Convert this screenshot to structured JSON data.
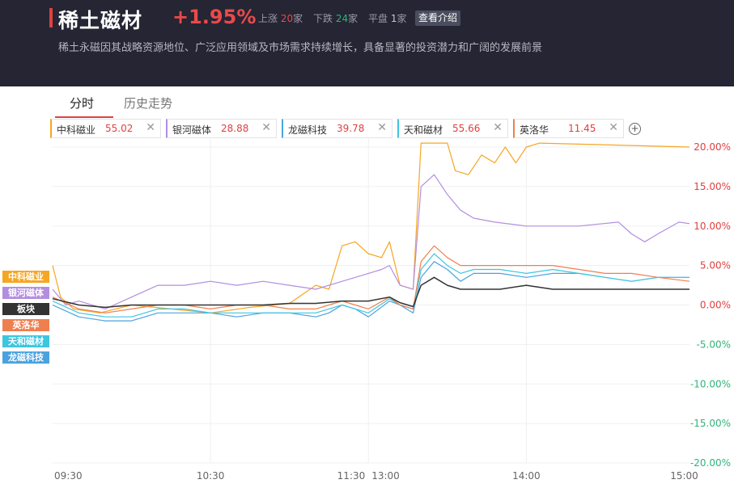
{
  "header": {
    "title": "稀土磁材",
    "change": "+1.95%",
    "up_label": "上涨",
    "up_count": "20",
    "down_label": "下跌",
    "down_count": "24",
    "flat_label": "平盘",
    "flat_count": "1",
    "unit": "家",
    "intro_button": "查看介绍",
    "description": "稀土永磁因其战略资源地位、广泛应用领域及市场需求持续增长，具备显著的投资潜力和广阔的发展前景"
  },
  "tabs": [
    {
      "label": "分时",
      "active": true
    },
    {
      "label": "历史走势",
      "active": false
    }
  ],
  "legend": [
    {
      "name": "中科磁业",
      "value": "55.02",
      "color": "#f5a623"
    },
    {
      "name": "银河磁体",
      "value": "28.88",
      "color": "#b38ee0"
    },
    {
      "name": "龙磁科技",
      "value": "39.78",
      "color": "#4aa3df"
    },
    {
      "name": "天和磁材",
      "value": "55.66",
      "color": "#3ec6e0"
    },
    {
      "name": "英洛华",
      "value": "11.45",
      "color": "#f07f4f"
    }
  ],
  "icons": {
    "close": "close-icon",
    "add": "add-circle-icon"
  },
  "side_tags": [
    {
      "label": "中科磁业",
      "color": "#f5a623"
    },
    {
      "label": "银河磁体",
      "color": "#b38ee0"
    },
    {
      "label": "板块",
      "color": "#333333"
    },
    {
      "label": "英洛华",
      "color": "#f07f4f"
    },
    {
      "label": "天和磁材",
      "color": "#3ec6e0"
    },
    {
      "label": "龙磁科技",
      "color": "#4aa3df"
    }
  ],
  "chart_data": {
    "type": "line",
    "x_ticks": [
      "09:30",
      "10:30",
      "11:30",
      "13:00",
      "14:00",
      "15:00"
    ],
    "y_ticks": [
      "20.00%",
      "15.00%",
      "10.00%",
      "5.00%",
      "0.00%",
      "-5.00%",
      "-10.00%",
      "-15.00%",
      "-20.00%"
    ],
    "ylim": [
      -20,
      20
    ],
    "x_points": 242,
    "positive_color": "#e0403f",
    "negative_color": "#2fb37a",
    "series": [
      {
        "name": "中科磁业",
        "color": "#f5a623",
        "values": [
          [
            0,
            5
          ],
          [
            3,
            1
          ],
          [
            8,
            -0.5
          ],
          [
            18,
            -1
          ],
          [
            30,
            0
          ],
          [
            45,
            -0.5
          ],
          [
            60,
            -1
          ],
          [
            75,
            -0.3
          ],
          [
            90,
            0.2
          ],
          [
            100,
            2.5
          ],
          [
            105,
            2
          ],
          [
            110,
            7.5
          ],
          [
            115,
            8
          ],
          [
            120,
            6.5
          ],
          [
            125,
            6
          ],
          [
            128,
            8
          ],
          [
            132,
            2.5
          ],
          [
            137,
            2
          ],
          [
            140,
            20.5
          ],
          [
            150,
            20.5
          ],
          [
            153,
            17
          ],
          [
            158,
            16.5
          ],
          [
            163,
            19
          ],
          [
            168,
            18
          ],
          [
            172,
            20
          ],
          [
            176,
            18
          ],
          [
            180,
            20
          ],
          [
            185,
            20.5
          ],
          [
            242,
            20
          ]
        ]
      },
      {
        "name": "银河磁体",
        "color": "#b38ee0",
        "values": [
          [
            0,
            2
          ],
          [
            5,
            0
          ],
          [
            10,
            0.5
          ],
          [
            20,
            -0.5
          ],
          [
            30,
            1
          ],
          [
            40,
            2.5
          ],
          [
            50,
            2.5
          ],
          [
            60,
            3
          ],
          [
            70,
            2.5
          ],
          [
            80,
            3
          ],
          [
            90,
            2.5
          ],
          [
            100,
            2
          ],
          [
            110,
            3
          ],
          [
            120,
            4
          ],
          [
            125,
            4.5
          ],
          [
            128,
            5
          ],
          [
            132,
            2.5
          ],
          [
            137,
            2
          ],
          [
            140,
            15
          ],
          [
            145,
            16.5
          ],
          [
            150,
            14
          ],
          [
            155,
            12
          ],
          [
            160,
            11
          ],
          [
            168,
            10.5
          ],
          [
            180,
            10
          ],
          [
            200,
            10
          ],
          [
            215,
            10.5
          ],
          [
            220,
            9
          ],
          [
            225,
            8
          ],
          [
            230,
            9
          ],
          [
            238,
            10.5
          ],
          [
            242,
            10.3
          ]
        ]
      },
      {
        "name": "龙磁科技",
        "color": "#4aa3df",
        "values": [
          [
            0,
            0
          ],
          [
            10,
            -1.5
          ],
          [
            20,
            -2
          ],
          [
            30,
            -2
          ],
          [
            40,
            -1
          ],
          [
            50,
            -1
          ],
          [
            60,
            -1
          ],
          [
            70,
            -1.5
          ],
          [
            80,
            -1
          ],
          [
            90,
            -1
          ],
          [
            100,
            -1.5
          ],
          [
            105,
            -1
          ],
          [
            110,
            0
          ],
          [
            115,
            -0.5
          ],
          [
            120,
            -1.5
          ],
          [
            128,
            0.5
          ],
          [
            132,
            0
          ],
          [
            137,
            -1
          ],
          [
            140,
            3.5
          ],
          [
            145,
            5.5
          ],
          [
            150,
            4.5
          ],
          [
            155,
            3
          ],
          [
            160,
            4
          ],
          [
            170,
            4
          ],
          [
            180,
            3.5
          ],
          [
            190,
            4
          ],
          [
            200,
            4
          ],
          [
            210,
            3.5
          ],
          [
            220,
            3
          ],
          [
            230,
            3.5
          ],
          [
            242,
            3.5
          ]
        ]
      },
      {
        "name": "天和磁材",
        "color": "#3ec6e0",
        "values": [
          [
            0,
            0.5
          ],
          [
            10,
            -1
          ],
          [
            20,
            -1.5
          ],
          [
            30,
            -1.5
          ],
          [
            40,
            -0.5
          ],
          [
            50,
            -0.5
          ],
          [
            60,
            -1
          ],
          [
            70,
            -1
          ],
          [
            80,
            -1
          ],
          [
            90,
            -1
          ],
          [
            100,
            -1
          ],
          [
            105,
            -0.5
          ],
          [
            110,
            0
          ],
          [
            115,
            -0.5
          ],
          [
            120,
            -1
          ],
          [
            128,
            0.8
          ],
          [
            132,
            0
          ],
          [
            137,
            -0.5
          ],
          [
            140,
            4.5
          ],
          [
            145,
            6.5
          ],
          [
            150,
            5
          ],
          [
            155,
            4
          ],
          [
            160,
            4.5
          ],
          [
            170,
            4.5
          ],
          [
            180,
            4
          ],
          [
            190,
            4.5
          ],
          [
            200,
            4
          ],
          [
            210,
            3.5
          ],
          [
            220,
            3
          ],
          [
            230,
            3.5
          ],
          [
            242,
            3.5
          ]
        ]
      },
      {
        "name": "英洛华",
        "color": "#f07f4f",
        "values": [
          [
            0,
            1
          ],
          [
            10,
            -0.5
          ],
          [
            20,
            -1
          ],
          [
            30,
            -0.5
          ],
          [
            40,
            0
          ],
          [
            50,
            0
          ],
          [
            60,
            -0.5
          ],
          [
            70,
            0
          ],
          [
            80,
            0
          ],
          [
            90,
            -0.5
          ],
          [
            100,
            -0.5
          ],
          [
            105,
            0
          ],
          [
            110,
            0.5
          ],
          [
            115,
            0
          ],
          [
            120,
            -0.5
          ],
          [
            128,
            1
          ],
          [
            132,
            0
          ],
          [
            137,
            -0.5
          ],
          [
            140,
            5.5
          ],
          [
            145,
            7.5
          ],
          [
            150,
            6
          ],
          [
            155,
            5
          ],
          [
            160,
            5
          ],
          [
            170,
            5
          ],
          [
            180,
            5
          ],
          [
            190,
            5
          ],
          [
            200,
            4.5
          ],
          [
            210,
            4
          ],
          [
            220,
            4
          ],
          [
            230,
            3.5
          ],
          [
            242,
            3
          ]
        ]
      },
      {
        "name": "板块",
        "color": "#333333",
        "values": [
          [
            0,
            0.8
          ],
          [
            10,
            0
          ],
          [
            20,
            -0.3
          ],
          [
            30,
            0
          ],
          [
            40,
            0
          ],
          [
            50,
            0
          ],
          [
            60,
            0
          ],
          [
            70,
            0
          ],
          [
            80,
            0
          ],
          [
            90,
            0.2
          ],
          [
            100,
            0.2
          ],
          [
            110,
            0.5
          ],
          [
            115,
            0.5
          ],
          [
            120,
            0.5
          ],
          [
            128,
            1
          ],
          [
            132,
            0.3
          ],
          [
            137,
            -0.2
          ],
          [
            140,
            2.5
          ],
          [
            145,
            3.5
          ],
          [
            150,
            2.5
          ],
          [
            155,
            2
          ],
          [
            160,
            2
          ],
          [
            170,
            2
          ],
          [
            180,
            2.5
          ],
          [
            190,
            2
          ],
          [
            200,
            2
          ],
          [
            210,
            2
          ],
          [
            220,
            2
          ],
          [
            230,
            2
          ],
          [
            242,
            2
          ]
        ]
      }
    ]
  }
}
